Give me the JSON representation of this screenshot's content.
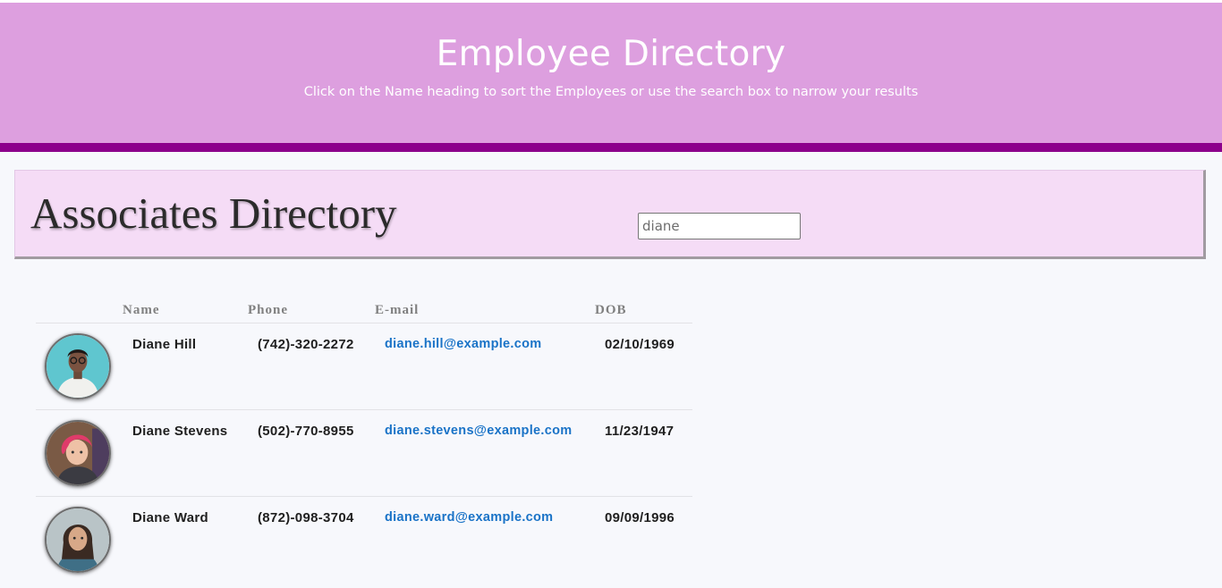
{
  "header": {
    "title": "Employee Directory",
    "subtitle": "Click on the Name heading to sort the Employees or use the search box to narrow your results"
  },
  "directory": {
    "title": "Associates Directory",
    "search_value": "diane"
  },
  "table": {
    "columns": [
      "Name",
      "Phone",
      "E-mail",
      "DOB"
    ],
    "rows": [
      {
        "name": "Diane Hill",
        "phone": "(742)-320-2272",
        "email": "diane.hill@example.com",
        "dob": "02/10/1969"
      },
      {
        "name": "Diane Stevens",
        "phone": "(502)-770-8955",
        "email": "diane.stevens@example.com",
        "dob": "11/23/1947"
      },
      {
        "name": "Diane Ward",
        "phone": "(872)-098-3704",
        "email": "diane.ward@example.com",
        "dob": "09/09/1996"
      }
    ]
  },
  "colors": {
    "header_bg": "#dd9fdf",
    "header_bar": "#8c008c",
    "directory_bg": "#f5dcf6",
    "link": "#1a73c7"
  }
}
